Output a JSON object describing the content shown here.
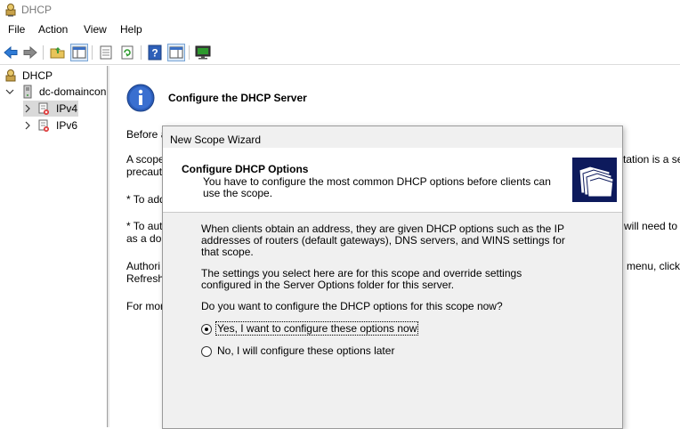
{
  "window": {
    "title": "DHCP"
  },
  "menu": [
    "File",
    "Action",
    "View",
    "Help"
  ],
  "toolbar": {
    "buttons": [
      "back-arrow-icon",
      "forward-arrow-icon",
      "up-folder-icon",
      "show-hide-tree-icon",
      "properties-icon",
      "refresh-icon",
      "help-icon",
      "show-hide-action-pane-icon",
      "console-icon"
    ]
  },
  "tree": {
    "root": "DHCP",
    "server": "dc-domaincon",
    "ipv4": "IPv4",
    "ipv6": "IPv6"
  },
  "main": {
    "heading": "Configure the DHCP Server",
    "para1": "Before a",
    "para2a": "A scope",
    "para2b": "precaut",
    "para3": "* To add",
    "para4a": "* To aut",
    "para4b": "as a dor",
    "para5a": "Authori",
    "para5b": "Refresh.",
    "para6": "For mor",
    "right1": "tation is a sec",
    "right2": "will need to",
    "right3": "menu, click"
  },
  "wizard": {
    "window_title": "New Scope Wizard",
    "header_title": "Configure DHCP Options",
    "header_subtitle": "You have to configure the most common DHCP options before clients can use the scope.",
    "body1": "When clients obtain an address, they are given DHCP options such as the IP addresses of routers (default gateways), DNS servers, and WINS settings for that scope.",
    "body2": "The settings you select here are for this scope and override settings configured in the Server Options folder for this server.",
    "question": "Do you want to configure the DHCP options for this scope now?",
    "option_yes": "Yes, I want to configure these options now",
    "option_no": "No, I will configure these options later",
    "selected": "yes"
  }
}
